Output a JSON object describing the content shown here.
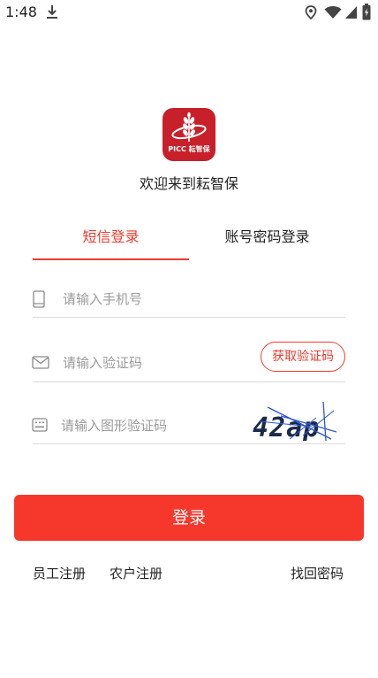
{
  "status_bar": {
    "time": "1:48",
    "icons": [
      "download-icon",
      "location-icon",
      "wifi-icon",
      "signal-icon",
      "battery-icon"
    ]
  },
  "app": {
    "logo_text": "PICC 耘智保",
    "welcome": "欢迎来到耘智保"
  },
  "tabs": [
    {
      "label": "短信登录",
      "active": true
    },
    {
      "label": "账号密码登录",
      "active": false
    }
  ],
  "form": {
    "phone": {
      "placeholder": "请输入手机号",
      "value": "",
      "icon": "phone-icon"
    },
    "sms_code": {
      "placeholder": "请输入验证码",
      "value": "",
      "icon": "mail-icon"
    },
    "get_code_label": "获取验证码",
    "captcha_input": {
      "placeholder": "请输入图形验证码",
      "value": "",
      "icon": "keyboard-icon"
    },
    "captcha_text": "42ap"
  },
  "login_label": "登录",
  "links": {
    "staff_register": "员工注册",
    "farmer_register": "农户注册",
    "recover_password": "找回密码"
  },
  "colors": {
    "accent": "#f03a2e",
    "button": "#f6372b",
    "logo_bg": "#c8202a"
  }
}
